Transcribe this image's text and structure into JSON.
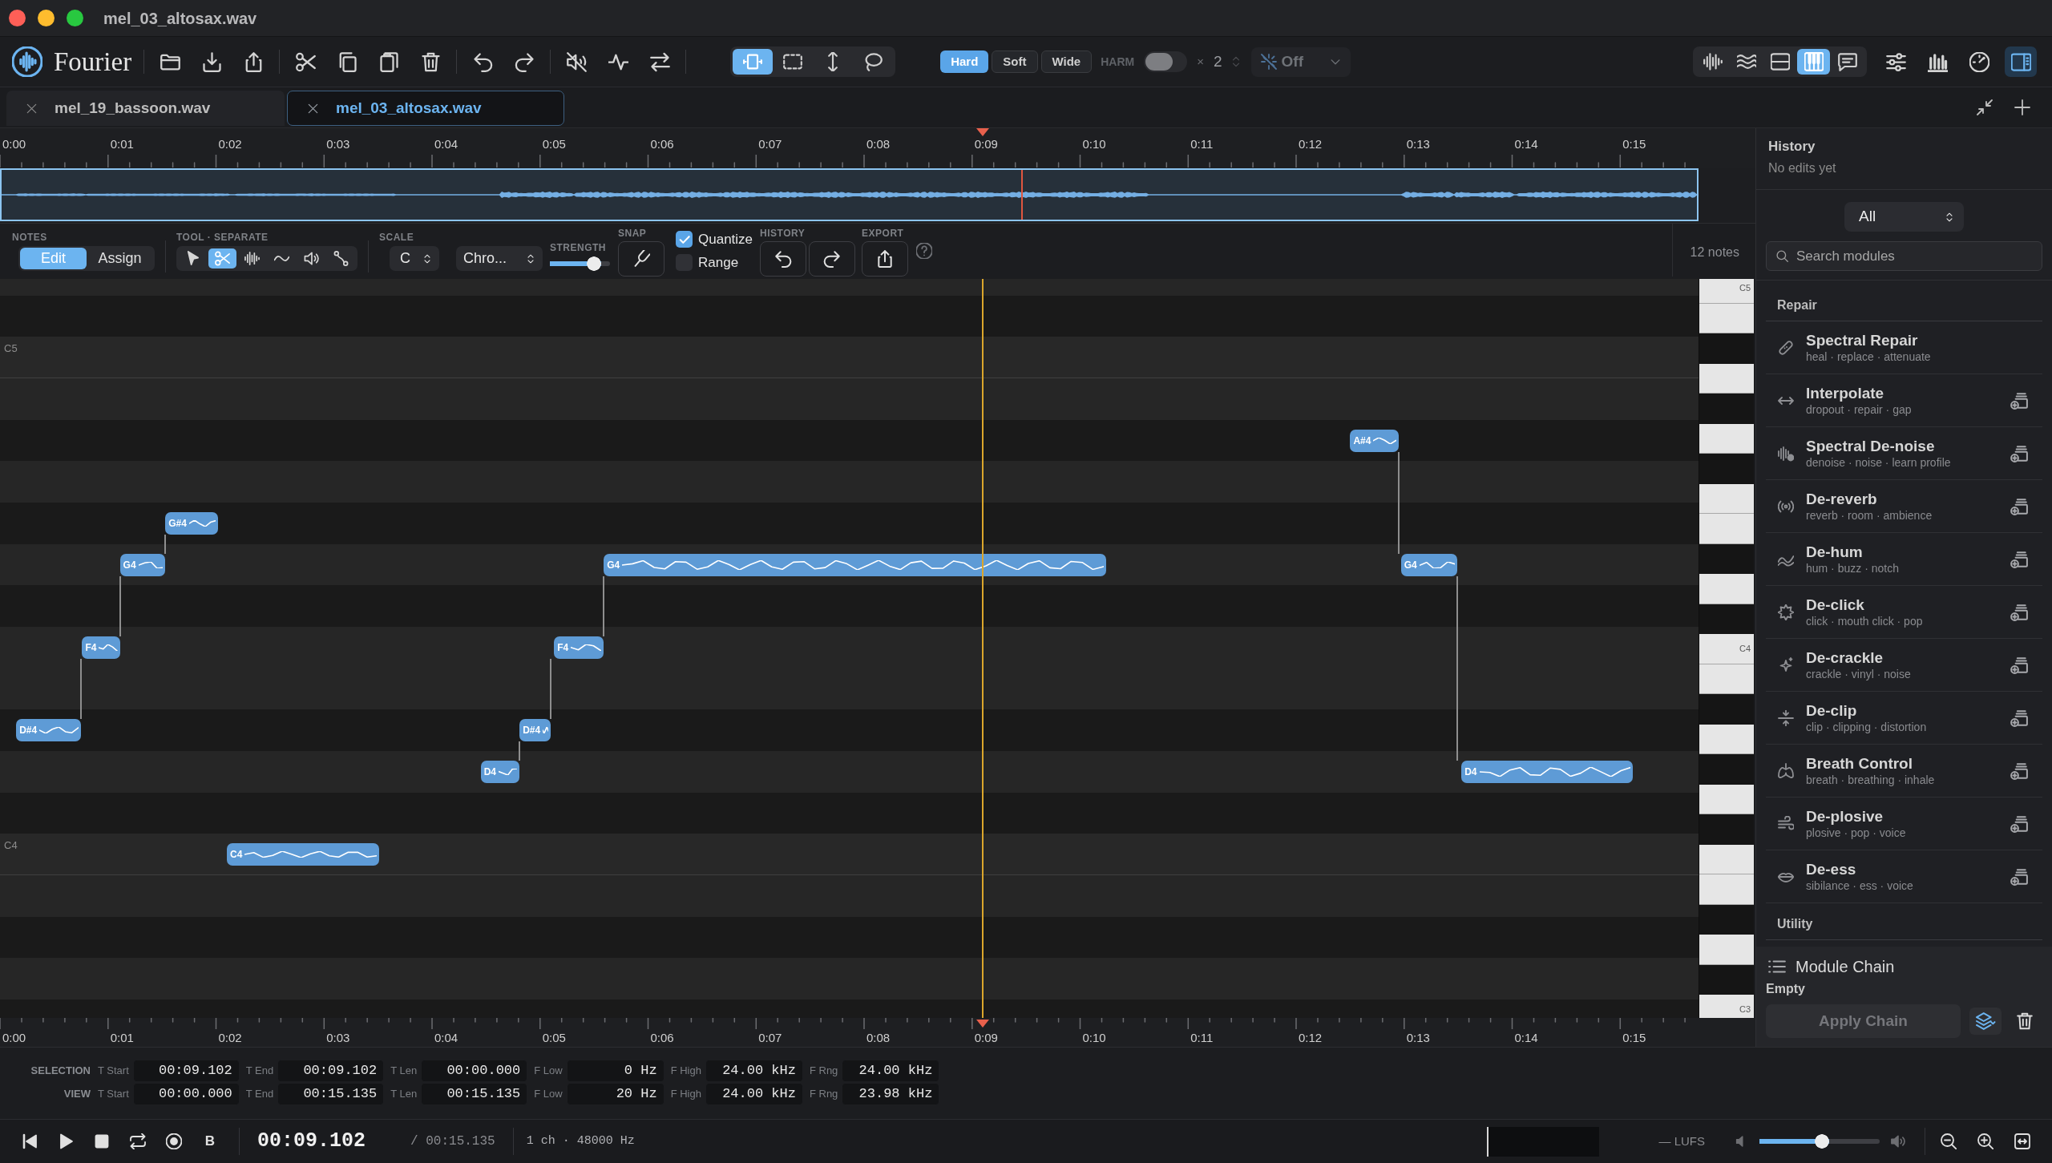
{
  "window": {
    "title": "mel_03_altosax.wav"
  },
  "toolbar": {
    "app_name": "Fourier",
    "selection_modes": [
      {
        "selected": true
      },
      {
        "selected": false
      },
      {
        "selected": false
      },
      {
        "selected": false
      }
    ],
    "clip_modes": [
      {
        "label": "Hard",
        "selected": true
      },
      {
        "label": "Soft",
        "selected": false
      },
      {
        "label": "Wide",
        "selected": false
      }
    ],
    "harmonics": {
      "label": "HARM",
      "on": false,
      "sign": "×",
      "count": "2"
    },
    "effect_dropdown": {
      "label": "Off",
      "disabled": true
    },
    "view_modes": [
      {
        "selected": false
      },
      {
        "selected": false
      },
      {
        "selected": false
      },
      {
        "selected": true
      },
      {
        "selected": false
      }
    ],
    "sidebar_toggle": {
      "on": true
    }
  },
  "tabs": [
    {
      "label": "mel_19_bassoon.wav",
      "selected": false
    },
    {
      "label": "mel_03_altosax.wav",
      "selected": true
    }
  ],
  "timeline": {
    "ruler": {
      "labels": [
        "0:00",
        "0:01",
        "0:02",
        "0:03",
        "0:04",
        "0:05",
        "0:06",
        "0:07",
        "0:08",
        "0:09",
        "0:10",
        "0:11",
        "0:12",
        "0:13",
        "0:14",
        "0:15"
      ]
    }
  },
  "notes_toolbar": {
    "notes": {
      "label": "NOTES",
      "modes": [
        {
          "label": "Edit",
          "selected": true
        },
        {
          "label": "Assign",
          "selected": false
        }
      ]
    },
    "tool": {
      "label": "TOOL · SEPARATE",
      "tools": [
        {
          "selected": false
        },
        {
          "selected": true
        },
        {
          "selected": false
        },
        {
          "selected": false
        },
        {
          "selected": false
        },
        {
          "selected": false
        }
      ]
    },
    "scale": {
      "label": "SCALE",
      "key": "C",
      "type": "Chro..."
    },
    "strength": {
      "label": "STRENGTH",
      "level": 0.85
    },
    "snap": {
      "label": "SNAP"
    },
    "quantize": {
      "label": "Quantize",
      "checked": true
    },
    "range": {
      "label": "Range",
      "checked": false
    },
    "history": {
      "label": "HISTORY"
    },
    "export": {
      "label": "EXPORT"
    },
    "note_count": "12 notes"
  },
  "piano_roll": {
    "row_labels": [
      "C5",
      "C4"
    ],
    "notes": [
      {
        "label": "D#4"
      },
      {
        "label": "F4"
      },
      {
        "label": "G4"
      },
      {
        "label": "G#4"
      },
      {
        "label": "C4"
      },
      {
        "label": "D4"
      },
      {
        "label": "D#4"
      },
      {
        "label": "F4"
      },
      {
        "label": "G4"
      },
      {
        "label": "A#4"
      },
      {
        "label": "G4"
      },
      {
        "label": "D4"
      }
    ],
    "keyboard_labels": [
      "C5",
      "C4",
      "C3"
    ]
  },
  "bottom_ruler": {
    "labels": [
      "0:00",
      "0:01",
      "0:02",
      "0:03",
      "0:04",
      "0:05",
      "0:06",
      "0:07",
      "0:08",
      "0:09",
      "0:10",
      "0:11",
      "0:12",
      "0:13",
      "0:14",
      "0:15"
    ]
  },
  "sidebar": {
    "history": {
      "title": "History",
      "status": "No edits yet"
    },
    "filter": {
      "value": "All"
    },
    "search": {
      "placeholder": "Search modules"
    },
    "sections": [
      {
        "title": "Repair",
        "modules": [
          {
            "name": "Spectral Repair",
            "tags": "heal · replace · attenuate",
            "addable": false
          },
          {
            "name": "Interpolate",
            "tags": "dropout · repair · gap",
            "addable": true
          },
          {
            "name": "Spectral De-noise",
            "tags": "denoise · noise · learn profile",
            "addable": true
          },
          {
            "name": "De-reverb",
            "tags": "reverb · room · ambience",
            "addable": true
          },
          {
            "name": "De-hum",
            "tags": "hum · buzz · notch",
            "addable": true
          },
          {
            "name": "De-click",
            "tags": "click · mouth click · pop",
            "addable": true
          },
          {
            "name": "De-crackle",
            "tags": "crackle · vinyl · noise",
            "addable": true
          },
          {
            "name": "De-clip",
            "tags": "clip · clipping · distortion",
            "addable": true
          },
          {
            "name": "Breath Control",
            "tags": "breath · breathing · inhale",
            "addable": true
          },
          {
            "name": "De-plosive",
            "tags": "plosive · pop · voice",
            "addable": true
          },
          {
            "name": "De-ess",
            "tags": "sibilance · ess · voice",
            "addable": true
          }
        ]
      },
      {
        "title": "Utility"
      }
    ],
    "module_chain": {
      "title": "Module Chain",
      "status": "Empty",
      "apply_label": "Apply Chain",
      "apply_disabled": true
    }
  },
  "info_rows": [
    {
      "label": "SELECTION",
      "fields": [
        {
          "label": "T Start",
          "value": "00:09.102"
        },
        {
          "label": "T End",
          "value": "00:09.102"
        },
        {
          "label": "T Len",
          "value": "00:00.000"
        },
        {
          "label": "F Low",
          "value": "0 Hz"
        },
        {
          "label": "F High",
          "value": "24.00 kHz"
        },
        {
          "label": "F Rng",
          "value": "24.00 kHz"
        }
      ]
    },
    {
      "label": "VIEW",
      "fields": [
        {
          "label": "T Start",
          "value": "00:00.000"
        },
        {
          "label": "T End",
          "value": "00:15.135"
        },
        {
          "label": "T Len",
          "value": "00:15.135"
        },
        {
          "label": "F Low",
          "value": "20 Hz"
        },
        {
          "label": "F High",
          "value": "24.00 kHz"
        },
        {
          "label": "F Rng",
          "value": "23.98 kHz"
        }
      ]
    }
  ],
  "transport": {
    "b_label": "B",
    "time": "00:09.102",
    "total": "/ 00:15.135",
    "format": "1 ch · 48000 Hz",
    "loudness": "— LUFS",
    "volume": {
      "level": 0.58
    }
  }
}
